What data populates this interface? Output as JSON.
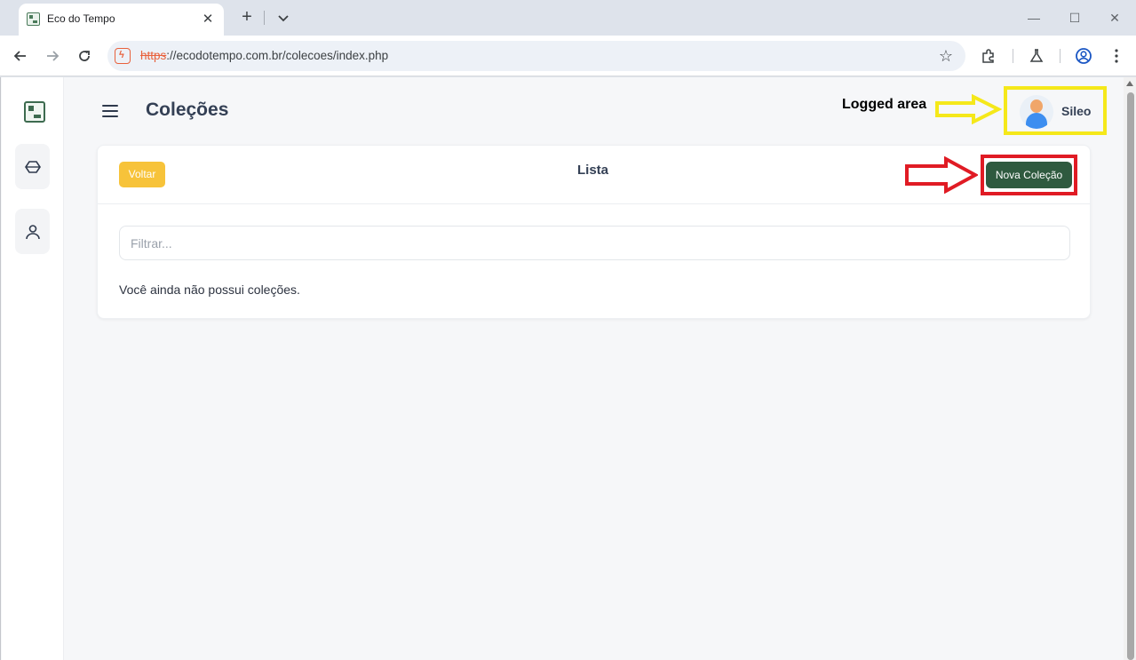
{
  "browser": {
    "tab_title": "Eco do Tempo",
    "tab_close": "✕",
    "new_tab": "+",
    "url_scheme": "https",
    "url_rest": "://ecodotempo.com.br/colecoes/index.php",
    "window_controls": {
      "minimize": "—",
      "maximize": "☐",
      "close": "✕"
    }
  },
  "header": {
    "title": "Coleções",
    "annotation_label": "Logged area",
    "user_name": "Sileo"
  },
  "card": {
    "back_label": "Voltar",
    "title": "Lista",
    "new_label": "Nova Coleção",
    "filter_placeholder": "Filtrar...",
    "empty_message": "Você ainda não possui coleções."
  },
  "colors": {
    "annotation_yellow": "#f5e81a",
    "annotation_red": "#e01b24",
    "back_button": "#f7c33a",
    "new_button": "#2f5a3f"
  },
  "icons": [
    "site-logo-icon",
    "cube-icon",
    "user-icon",
    "hamburger-icon",
    "avatar-icon"
  ]
}
